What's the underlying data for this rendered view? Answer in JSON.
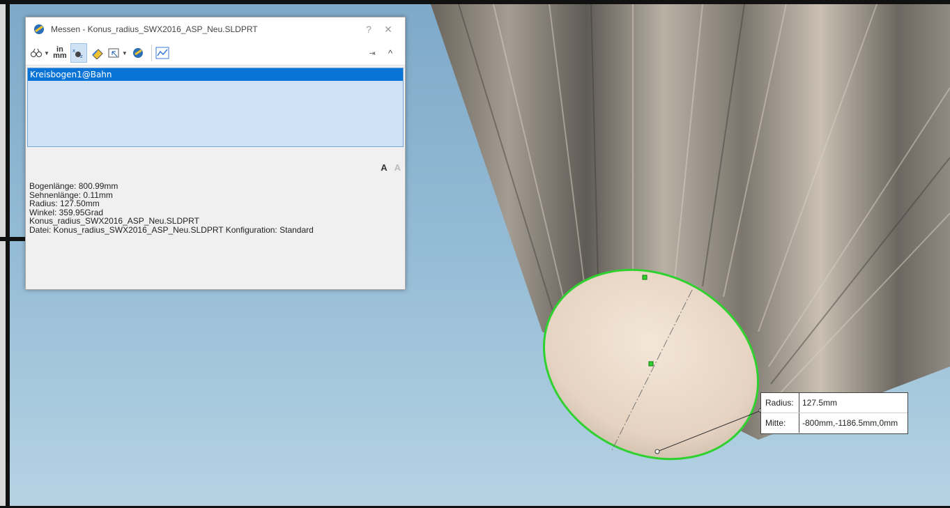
{
  "window": {
    "title": "Messen - Konus_radius_SWX2016_ASP_Neu.SLDPRT",
    "help_label": "?",
    "close_label": "✕"
  },
  "toolbar": {
    "units_top": "in",
    "units_bottom": "mm",
    "pin_label": "⇥",
    "collapse_label": "^"
  },
  "selection": {
    "items": [
      "Kreisbogen1@Bahn"
    ]
  },
  "font_buttons": {
    "increase": "A",
    "decrease": "A"
  },
  "results": {
    "lines": [
      "Bogenlänge: 800.99mm",
      "Sehnenlänge: 0.11mm",
      "Radius: 127.50mm",
      "Winkel: 359.95Grad",
      "Konus_radius_SWX2016_ASP_Neu.SLDPRT",
      "Datei: Konus_radius_SWX2016_ASP_Neu.SLDPRT Konfiguration: Standard"
    ]
  },
  "tooltip": {
    "radius_label": "Radius:",
    "radius_value": "127.5mm",
    "center_label": "Mitte:",
    "center_value": "-800mm,-1186.5mm,0mm"
  },
  "colors": {
    "selection_highlight": "#0a74d6",
    "listbox_bg": "#cfe1f5",
    "edge_highlight": "#2fd12f",
    "sky_top": "#7ea9c8",
    "sky_bottom": "#b5d3e3"
  }
}
